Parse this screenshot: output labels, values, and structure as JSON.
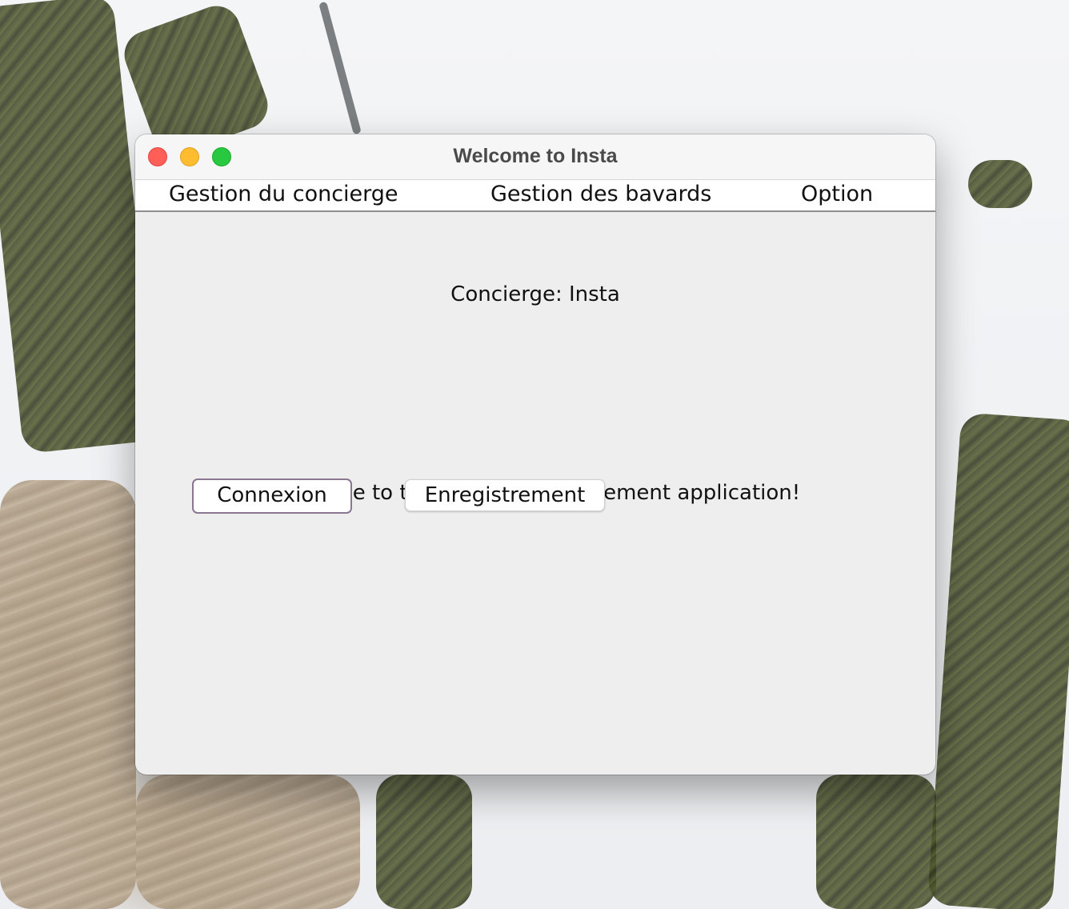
{
  "window": {
    "title": "Welcome to Insta"
  },
  "menubar": {
    "items": [
      {
        "label": "Gestion du concierge"
      },
      {
        "label": "Gestion des bavards"
      },
      {
        "label": "Option"
      }
    ]
  },
  "main": {
    "concierge_label": "Concierge: Insta",
    "welcome_message": "Welcome to the Bavards management application!",
    "buttons": {
      "connexion": "Connexion",
      "enregistrement": "Enregistrement"
    }
  },
  "colors": {
    "traffic_close": "#ff5f57",
    "traffic_minimize": "#febc2e",
    "traffic_zoom": "#28c840",
    "window_background": "#eeeeee",
    "focus_ring": "#8a7691"
  }
}
